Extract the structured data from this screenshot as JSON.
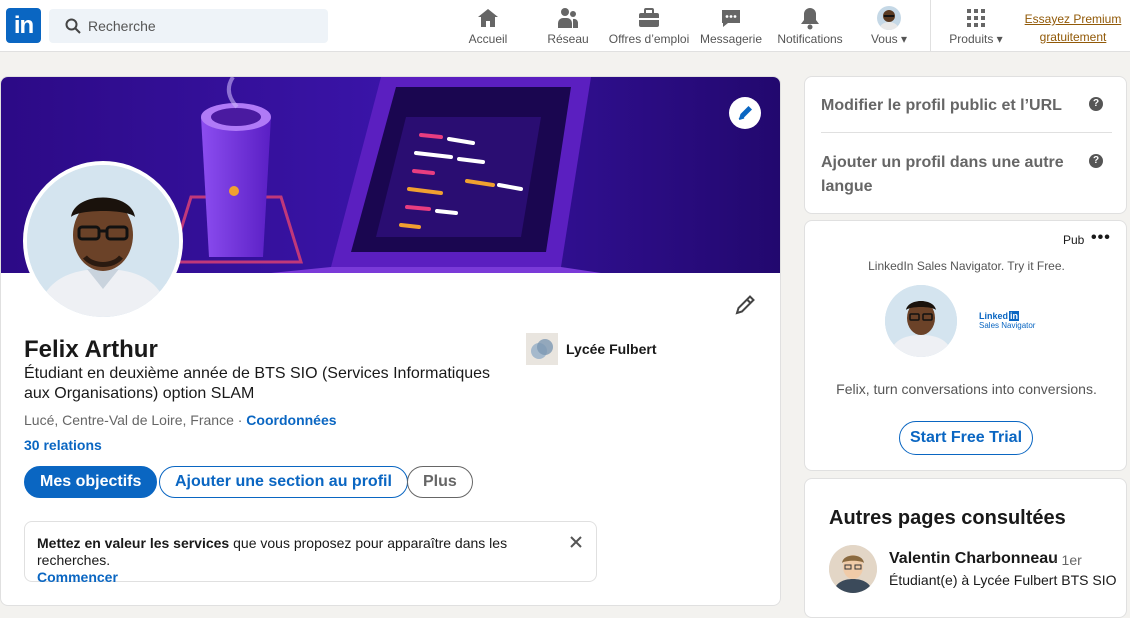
{
  "nav": {
    "logo": "in",
    "search_placeholder": "Recherche",
    "items": [
      {
        "label": "Accueil",
        "icon": "home-icon"
      },
      {
        "label": "Réseau",
        "icon": "network-icon"
      },
      {
        "label": "Offres d’emploi",
        "icon": "briefcase-icon"
      },
      {
        "label": "Messagerie",
        "icon": "messaging-icon"
      },
      {
        "label": "Notifications",
        "icon": "bell-icon"
      },
      {
        "label": "Vous",
        "icon": "avatar"
      },
      {
        "label": "Produits",
        "icon": "grid-icon"
      }
    ],
    "premium_line1": "Essayez Premium",
    "premium_line2": "gratuitement"
  },
  "profile": {
    "name": "Felix Arthur",
    "headline": "Étudiant en deuxième année de BTS SIO (Services Informatiques aux Organisations) option SLAM",
    "location": "Lucé, Centre-Val de Loire, France · ",
    "contact_link": "Coordonnées",
    "relations": "30 relations",
    "school": "Lycée Fulbert",
    "buttons": {
      "primary": "Mes objectifs",
      "add_section": "Ajouter une section au profil",
      "more": "Plus"
    },
    "services_bold": "Mettez en valeur les services",
    "services_text": " que vous proposez pour apparaître dans les recherches.",
    "services_link": "Commencer"
  },
  "sidebar": {
    "edit_public": "Modifier le profil public et l’URL",
    "add_language": "Ajouter un profil dans une autre langue",
    "help_glyph": "?",
    "ad": {
      "label": "Pub",
      "more": "•••",
      "tagline": "LinkedIn Sales Navigator. Try it Free.",
      "brand_line1": "Linked",
      "brand_in": "in",
      "brand_line2": "Sales Navigator",
      "message": "Felix, turn conversations into conversions.",
      "cta": "Start Free Trial"
    },
    "other_pages": {
      "title": "Autres pages consultées",
      "person_name": "Valentin Charbonneau",
      "person_degree": "· 1er",
      "person_sub": "Étudiant(e) à Lycée Fulbert BTS SIO"
    }
  },
  "colors": {
    "accent": "#0a66c2",
    "premium": "#915907",
    "banner_dark": "#2a0a7a",
    "banner_light": "#6a2cd8"
  }
}
